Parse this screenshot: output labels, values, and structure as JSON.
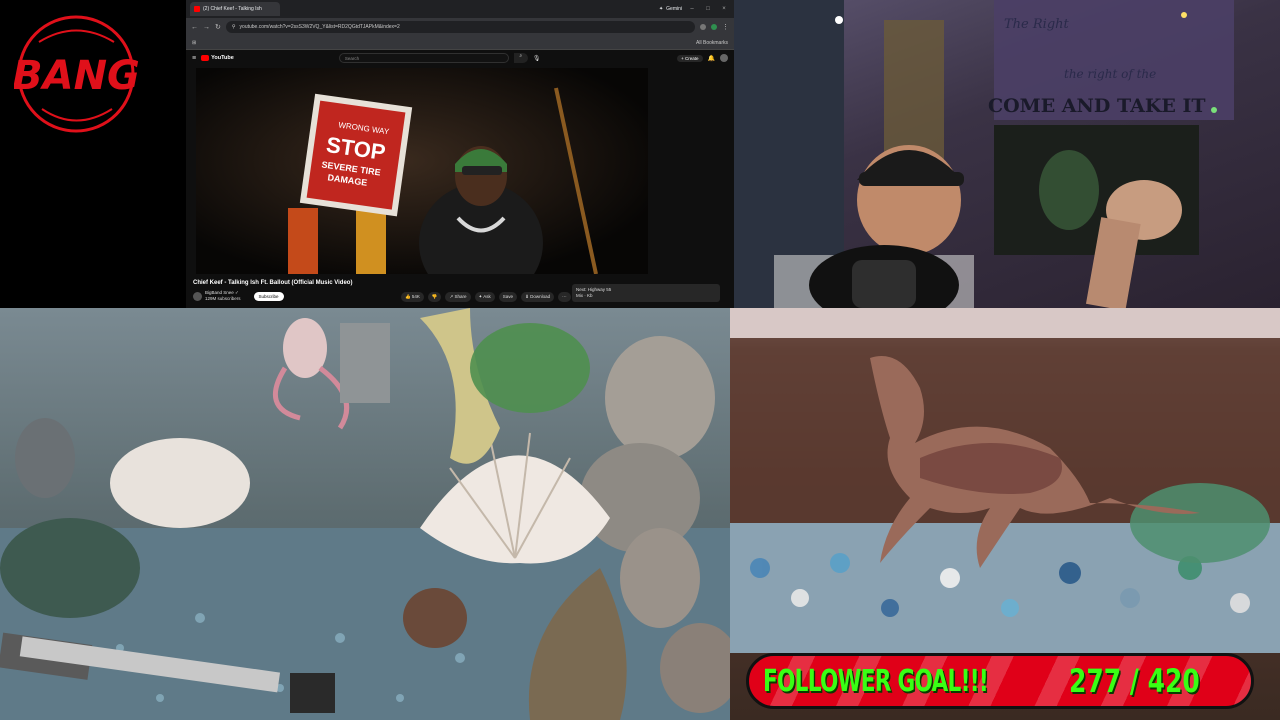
{
  "logo": {
    "text": "BANG",
    "ring_color": "#e0101a"
  },
  "browser": {
    "tab_title": "(2) Chief Keef - Talking Ish",
    "gemini_label": "Gemini",
    "url": "youtube.com/watch?v=2ssS3W2VQ_Y&list=RD2QGtdTJAPkM&index=2",
    "bookmarks_label": "All Bookmarks",
    "yt_brand": "YouTube",
    "search_placeholder": "Search",
    "create_label": "+ Create",
    "video_title": "Chief Keef - Talking Ish Ft. Ballout (Official Music Video)",
    "channel_name": "BigBand Snee ✓",
    "channel_subs": "129M subscribers",
    "subscribe_label": "Subscribe",
    "actions": [
      "👍 54K",
      "👎",
      "↗ Share",
      "✦ Ask",
      "Save",
      "⬇ Download",
      "⋯"
    ],
    "next_title": "Next: Highway 55",
    "next_sub": "Mix · Kb"
  },
  "video_scene": {
    "sign_top": "WRONG WAY",
    "sign_main": "STOP",
    "sign_sub1": "SEVERE TIRE",
    "sign_sub2": "DAMAGE"
  },
  "webcam": {
    "flag_text_top": "The Right",
    "flag_text_mid": "the right of the",
    "flag_text_bottom": "COME AND TAKE IT"
  },
  "follower_goal": {
    "label": "FOLLOWER GOAL!!!",
    "count": "277 / 420",
    "bar_color": "#e00018",
    "text_color": "#39ff14"
  }
}
